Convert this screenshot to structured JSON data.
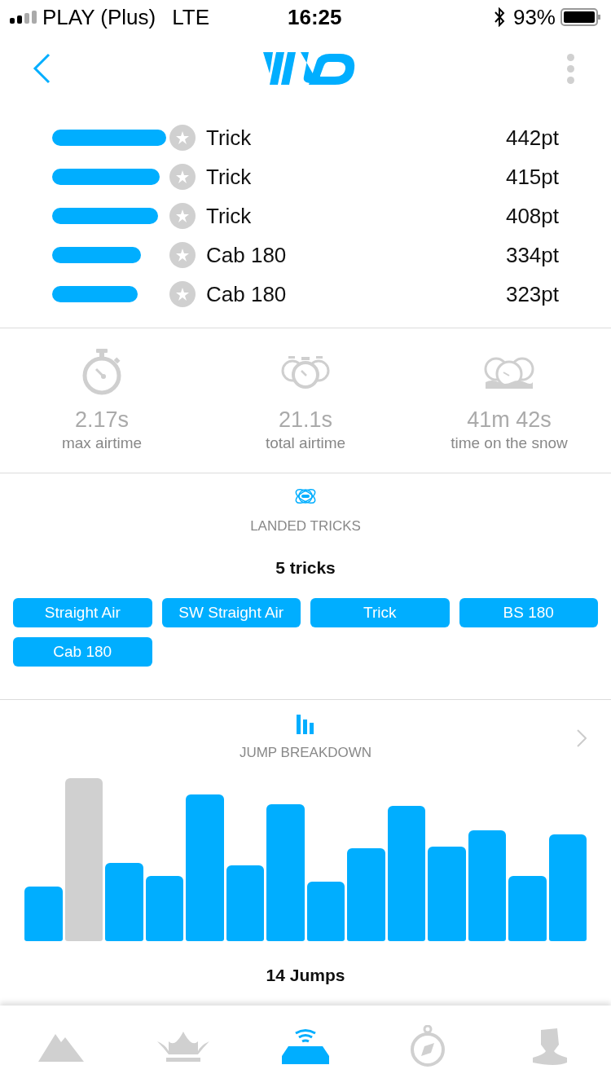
{
  "status_bar": {
    "carrier": "PLAY (Plus)",
    "network": "LTE",
    "time": "16:25",
    "battery": "93%"
  },
  "top_tricks": [
    {
      "name": "Trick",
      "points": "442pt"
    },
    {
      "name": "Trick",
      "points": "415pt"
    },
    {
      "name": "Trick",
      "points": "408pt"
    },
    {
      "name": "Cab 180",
      "points": "334pt"
    },
    {
      "name": "Cab 180",
      "points": "323pt"
    }
  ],
  "stats": [
    {
      "kind": "single",
      "value": "2.17s",
      "label": "max airtime"
    },
    {
      "kind": "multi",
      "value": "21.1s",
      "label": "total airtime"
    },
    {
      "kind": "snow",
      "value": "41m 42s",
      "label": "time on the snow"
    }
  ],
  "landed_tricks": {
    "title": "LANDED TRICKS",
    "count": "5 tricks",
    "tags": [
      "Straight Air",
      "SW Straight Air",
      "Trick",
      "BS 180",
      "Cab 180"
    ]
  },
  "jump_breakdown": {
    "title": "JUMP BREAKDOWN",
    "count": "14 Jumps",
    "jumps": [
      {
        "selected": false
      },
      {
        "selected": true
      },
      {
        "selected": false
      },
      {
        "selected": false
      },
      {
        "selected": false
      },
      {
        "selected": false
      },
      {
        "selected": false
      },
      {
        "selected": false
      },
      {
        "selected": false
      },
      {
        "selected": false
      },
      {
        "selected": false
      },
      {
        "selected": false
      },
      {
        "selected": false
      },
      {
        "selected": false
      }
    ]
  },
  "tab_bar": [
    {
      "kind": "mountain",
      "selected": false
    },
    {
      "kind": "crown",
      "selected": false
    },
    {
      "kind": "device",
      "selected": true
    },
    {
      "kind": "compass",
      "selected": false
    },
    {
      "kind": "profile",
      "selected": false
    }
  ]
}
